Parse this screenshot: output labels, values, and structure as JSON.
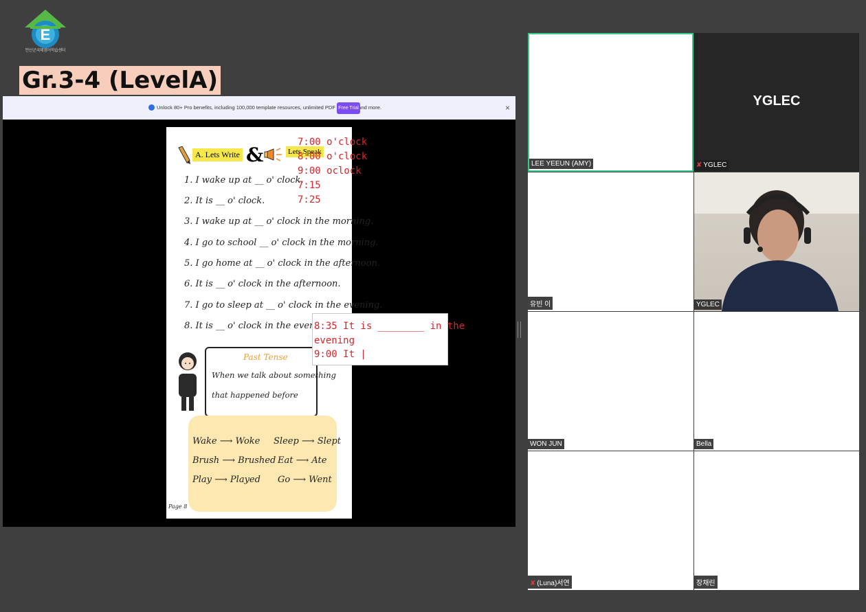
{
  "header": {
    "logo_text": "안산군국제영어학습센터",
    "class_title": "Gr.3-4 (LevelA)"
  },
  "share": {
    "promo_text": "Unlock 80+ Pro benefits, including 100,000 template resources, unlimited PDF features, and more.",
    "free_trial_label": "Free Trial",
    "close_icon": "×",
    "worksheet": {
      "lets_write": "A. Lets Write",
      "ampersand": "&",
      "lets_speak": "Lets Speak",
      "times": [
        "7:00 o'clock",
        "8:00 o'clock",
        "9:00 oclock",
        "7:15",
        "7:25"
      ],
      "sentences": [
        "1. I wake up at __ o' clock.",
        "2. It is __ o' clock.",
        "3. I wake up at __ o' clock in the morning.",
        "4. I go to school __ o' clock in the morning.",
        "5. I go home at __ o' clock in the afternoon.",
        "6. It is __ o' clock in the afternoon.",
        "7. I go to sleep at __ o' clock in the evening.",
        "8. It is __ o' clock in the evening."
      ],
      "textbox_line1": "8:35 It is ________ in the",
      "textbox_line2": "evening",
      "textbox_line3": "9:00 It |",
      "past_tense_title": "Past Tense",
      "past_tense_line1": "When we talk about something",
      "past_tense_line2": "that happened before",
      "verbs": [
        {
          "base": "Wake",
          "past": "Woke"
        },
        {
          "base": "Sleep",
          "past": "Slept"
        },
        {
          "base": "Brush",
          "past": "Brushed"
        },
        {
          "base": "Eat",
          "past": "Ate"
        },
        {
          "base": "Play",
          "past": "Played"
        },
        {
          "base": "Go",
          "past": "Went"
        }
      ],
      "arrow": "⟶",
      "page_label": "Page 8"
    }
  },
  "participants": [
    {
      "name": "LEE YEEUN (AMY)",
      "muted": false
    },
    {
      "name": "YGLEC",
      "muted": true,
      "display_text": "YGLEC"
    },
    {
      "name": "유빈 이",
      "muted": false
    },
    {
      "name": "YGLEC",
      "muted": false
    },
    {
      "name": "WON JUN",
      "muted": false
    },
    {
      "name": "Bella",
      "muted": false
    },
    {
      "name": "(Luna)서연",
      "muted": true
    },
    {
      "name": "장채린",
      "muted": false
    }
  ],
  "colors": {
    "background": "#3f3f3f",
    "title_bg": "#f7cdbb",
    "active_speaker_border": "#3cc88a",
    "muted_icon": "#e23b3b",
    "free_trial": "#7b4cf0",
    "annotation_red": "#d4262c"
  }
}
